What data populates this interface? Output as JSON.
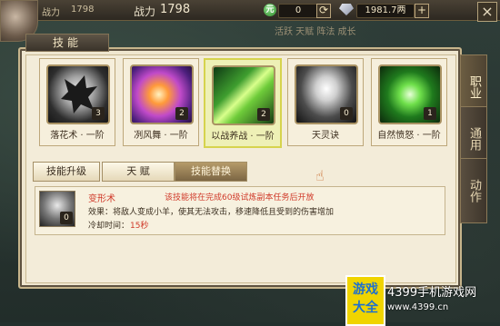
{
  "hud": {
    "left_label": "战力",
    "left_value": "1798",
    "label": "战力",
    "value": "1798",
    "gold_icon": "元",
    "gold": "0",
    "currency": "1981.7两",
    "plus": "+",
    "close": "×",
    "faded_line": "活跃  天赋  阵法  成长"
  },
  "panel": {
    "title": "技能"
  },
  "side_tabs": [
    {
      "label": "职业"
    },
    {
      "label": "通用"
    },
    {
      "label": "动作"
    }
  ],
  "skills": [
    {
      "name": "落花术 · 一阶",
      "level": "3",
      "icon": "dark-creature-icon"
    },
    {
      "name": "冽风舞 · 一阶",
      "level": "2",
      "icon": "purple-flame-icon"
    },
    {
      "name": "以战养战 · 一阶",
      "level": "2",
      "icon": "green-slash-icon"
    },
    {
      "name": "天灵诀",
      "level": "0",
      "icon": "white-spirit-icon"
    },
    {
      "name": "自然愤怒 · 一阶",
      "level": "1",
      "icon": "green-orb-icon"
    }
  ],
  "buttons": {
    "upgrade": "技能升级",
    "talent": "天   赋",
    "replace": "技能替换"
  },
  "detail": {
    "name": "变形术",
    "notice": "该技能将在完成60级试炼副本任务后开放",
    "effect": "效果：将敌人变成小羊，使其无法攻击，移速降低且受到的伤害增加",
    "cooldown_label": "冷却时间：",
    "cooldown_value": "15秒",
    "level": "0"
  },
  "watermark": {
    "box_line1": "游戏",
    "box_line2": "大全",
    "site_name": "4399手机游戏网",
    "site_url": "www.4399.cn"
  },
  "colors": {
    "accent_red": "#d03a2a",
    "panel_bg": "#efe6cf",
    "selected_card": "#eef0b6"
  }
}
